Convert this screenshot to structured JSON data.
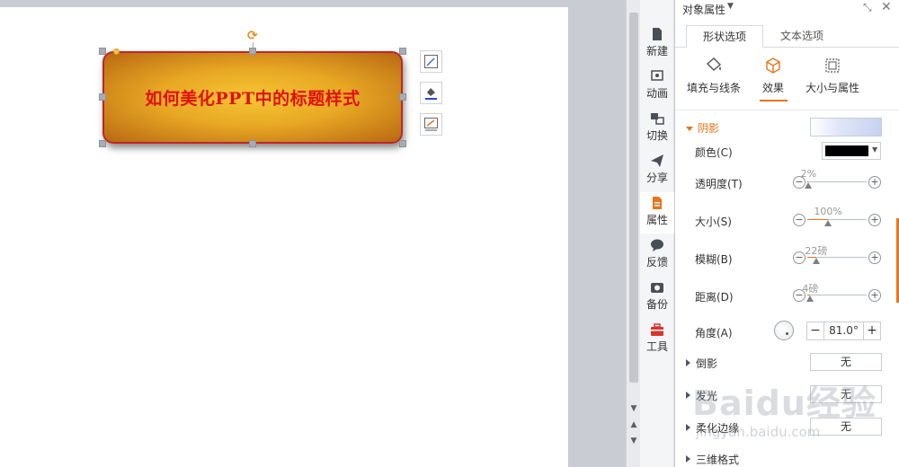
{
  "slide": {
    "title_text": "如何美化PPT中的标题样式"
  },
  "side_tabs": [
    {
      "label": "新建",
      "icon": "new-file-icon"
    },
    {
      "label": "动画",
      "icon": "animation-icon"
    },
    {
      "label": "切换",
      "icon": "transition-icon"
    },
    {
      "label": "分享",
      "icon": "share-icon"
    },
    {
      "label": "属性",
      "icon": "properties-icon",
      "active": true
    },
    {
      "label": "反馈",
      "icon": "feedback-icon"
    },
    {
      "label": "备份",
      "icon": "backup-icon"
    },
    {
      "label": "工具",
      "icon": "toolbox-icon"
    }
  ],
  "panel": {
    "title": "对象属性",
    "tabs": [
      "形状选项",
      "文本选项"
    ],
    "sub_tabs": [
      "填充与线条",
      "效果",
      "大小与属性"
    ],
    "shadow": {
      "heading": "阴影",
      "color_label": "颜色(C)",
      "color_value": "#000000",
      "transparency_label": "透明度(T)",
      "transparency_value": "2%",
      "transparency_level": 0.02,
      "size_label": "大小(S)",
      "size_value": "100%",
      "size_level": 0.35,
      "blur_label": "模糊(B)",
      "blur_value": "22磅",
      "blur_level": 0.15,
      "distance_label": "距离(D)",
      "distance_value": "4磅",
      "distance_level": 0.05,
      "angle_label": "角度(A)",
      "angle_value": "81.0°"
    },
    "sections": [
      {
        "label": "倒影",
        "value": "无"
      },
      {
        "label": "发光",
        "value": "无"
      },
      {
        "label": "柔化边缘",
        "value": "无"
      },
      {
        "label": "三维格式",
        "value": ""
      }
    ]
  },
  "watermark": {
    "logo": "Baidu经验",
    "url": "jingyan.baidu.com"
  },
  "colors": {
    "accent": "#e8741c",
    "title_text": "#e01010",
    "shape_border": "#c0262a"
  }
}
